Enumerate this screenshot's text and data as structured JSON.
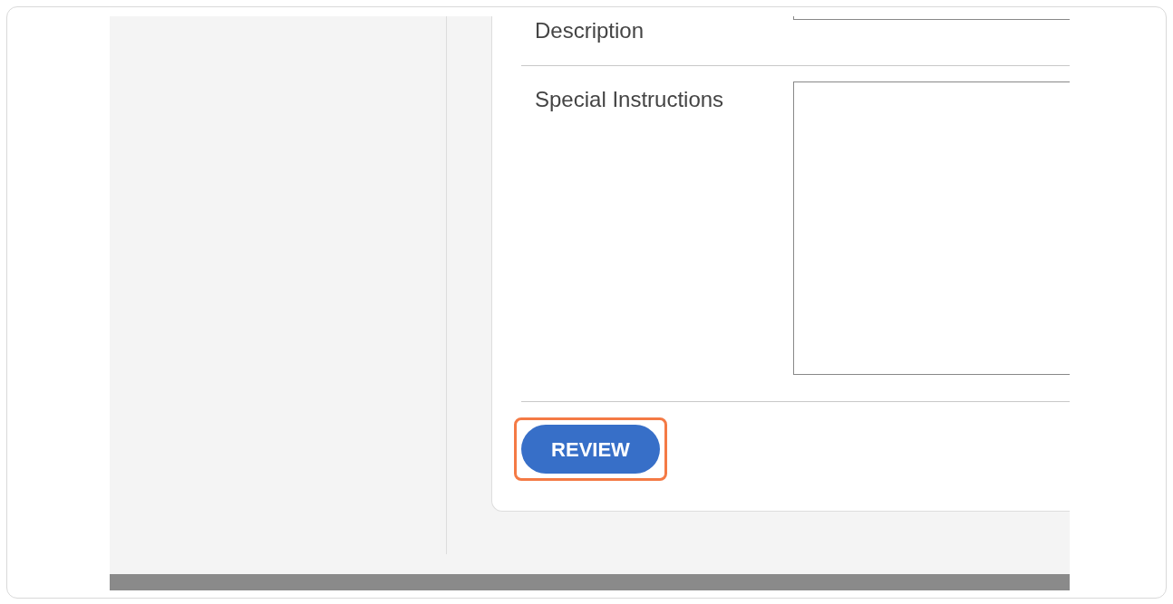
{
  "form": {
    "fields": [
      {
        "label": "Description",
        "kind": "input"
      },
      {
        "label": "Special Instructions",
        "kind": "textarea"
      }
    ],
    "button": {
      "label": "REVIEW",
      "highlighted": true
    }
  }
}
